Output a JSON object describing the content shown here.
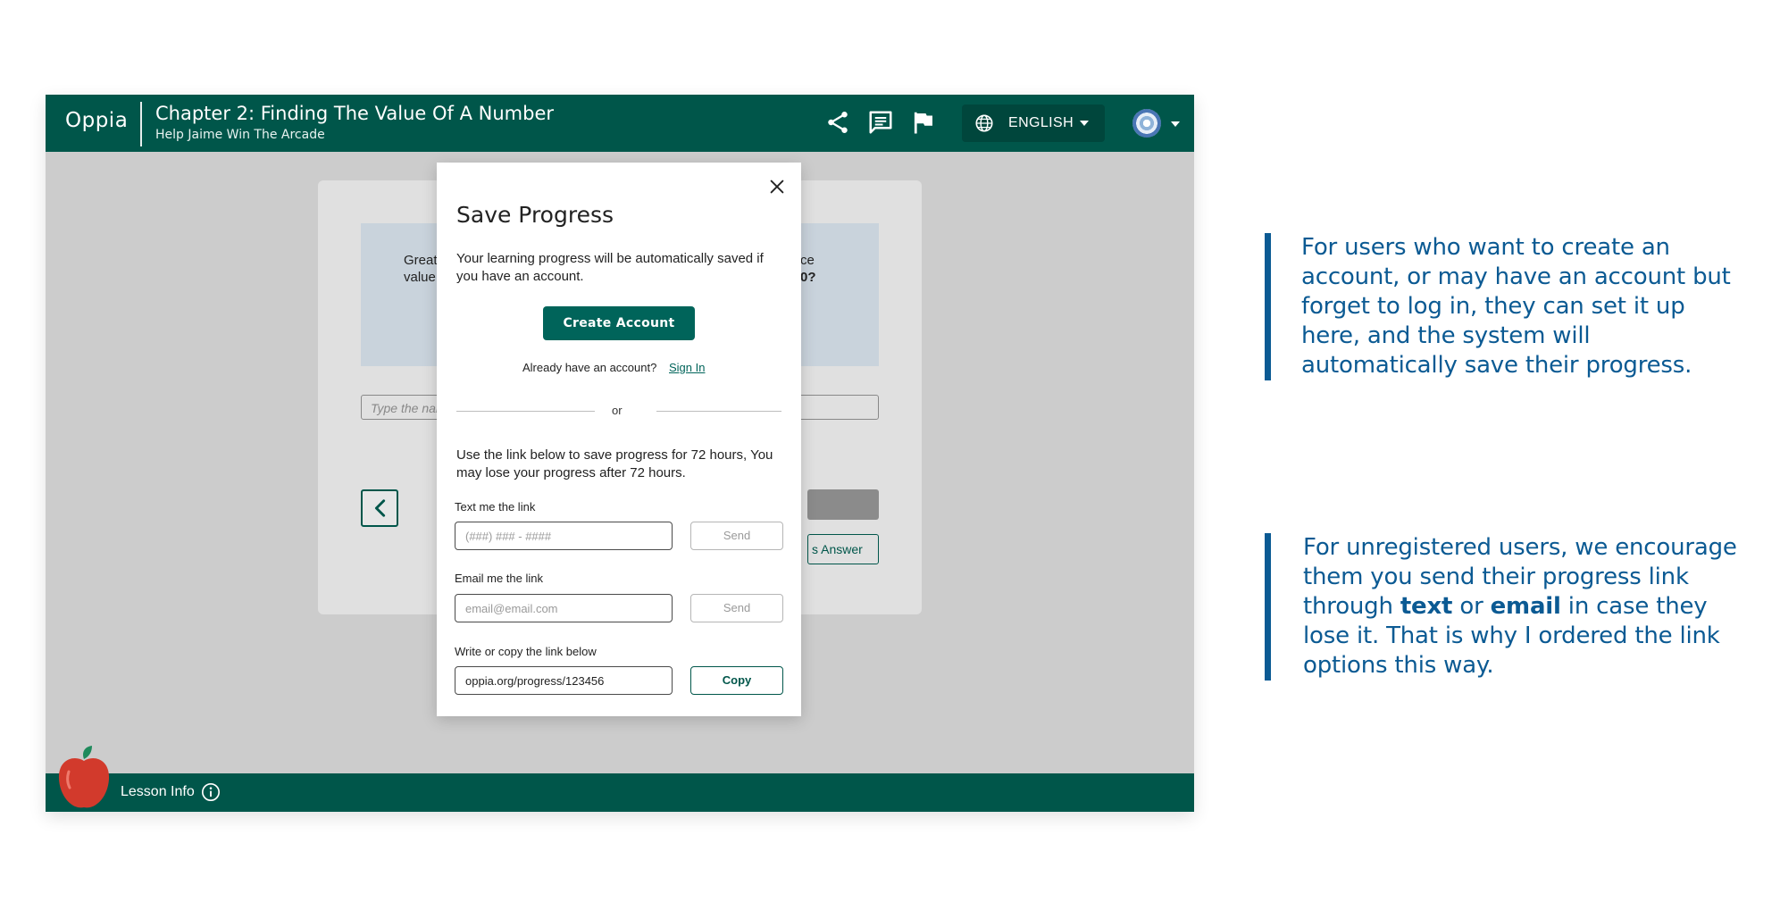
{
  "header": {
    "logo": "Oppia",
    "chapter_title": "Chapter 2: Finding The Value Of A Number",
    "chapter_subtitle": "Help Jaime Win The Arcade",
    "language": "ENGLISH",
    "icons": [
      "share-icon",
      "feedback-icon",
      "flag-icon",
      "globe-icon",
      "avatar"
    ]
  },
  "lesson": {
    "question_left": [
      "Great",
      "value"
    ],
    "question_right": [
      "ce",
      "0?"
    ],
    "answer_placeholder": "Type the nar",
    "answer_button": "s Answer"
  },
  "modal": {
    "title": "Save Progress",
    "description": "Your learning progress will be automatically saved if you have an account.",
    "create_account": "Create Account",
    "already_text": "Already have an account?",
    "sign_in": "Sign In",
    "or": "or",
    "note": "Use the link below to save progress for 72 hours, You may lose your progress after 72 hours.",
    "text_label": "Text me the link",
    "phone_placeholder": "(###) ### - ####",
    "email_label": "Email me the link",
    "email_placeholder": "email@email.com",
    "send": "Send",
    "copy_label": "Write or copy the link below",
    "copy_link_value": "oppia.org/progress/123456",
    "copy": "Copy"
  },
  "footer": {
    "lesson_info": "Lesson Info"
  },
  "annotations": {
    "first": "For users who want to create an account, or may have an account but forget to log in, they can set it up here, and the system will automatically save their progress.",
    "second_part1": "For unregistered users, we encourage them you send their progress link through ",
    "second_text_word": "text",
    "second_or": " or ",
    "second_email_word": "email",
    "second_part2": " in case they lose it. That is why I ordered the link options this way."
  },
  "colors": {
    "brand": "#00564a",
    "button": "#00645a",
    "annotation": "#0b5a93",
    "backdrop": "#cccccc"
  }
}
